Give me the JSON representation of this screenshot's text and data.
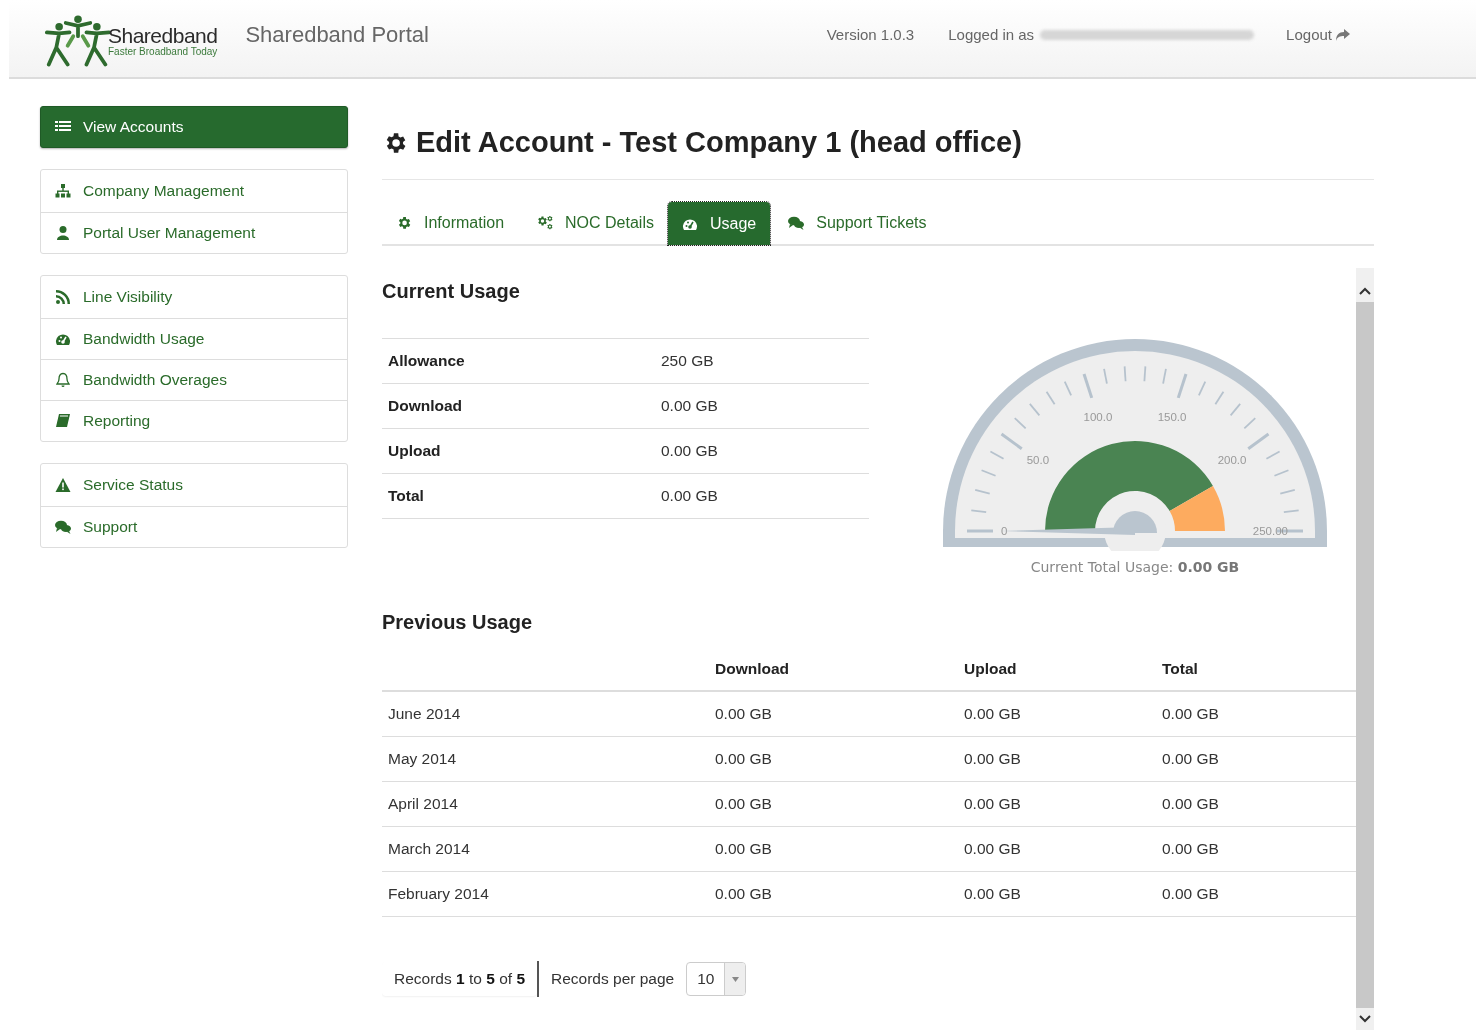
{
  "header": {
    "brand": "Sharedband",
    "tagline": "Faster Broadband Today",
    "portal": "Sharedband Portal",
    "version": "Version 1.0.3",
    "logged_in": "Logged in as",
    "logout": "Logout"
  },
  "sidebar": {
    "groups": [
      [
        {
          "label": "View Accounts",
          "selected": true
        }
      ],
      [
        {
          "label": "Company Management",
          "selected": false
        },
        {
          "label": "Portal User Management",
          "selected": false
        }
      ],
      [
        {
          "label": "Line Visibility",
          "selected": false
        },
        {
          "label": "Bandwidth Usage",
          "selected": false
        },
        {
          "label": "Bandwidth Overages",
          "selected": false
        },
        {
          "label": "Reporting",
          "selected": false
        }
      ],
      [
        {
          "label": "Service Status",
          "selected": false
        },
        {
          "label": "Support",
          "selected": false
        }
      ]
    ]
  },
  "page_title": "Edit Account - Test Company 1 (head office)",
  "tabs": [
    {
      "label": "Information",
      "selected": false
    },
    {
      "label": "NOC Details",
      "selected": false
    },
    {
      "label": "Usage",
      "selected": true
    },
    {
      "label": "Support Tickets",
      "selected": false
    }
  ],
  "current_usage": {
    "heading": "Current Usage",
    "rows": [
      {
        "label": "Allowance",
        "value": "250 GB"
      },
      {
        "label": "Download",
        "value": "0.00 GB"
      },
      {
        "label": "Upload",
        "value": "0.00 GB"
      },
      {
        "label": "Total",
        "value": "0.00 GB"
      }
    ],
    "gauge": {
      "ticks": [
        "0",
        "50.0",
        "100.0",
        "150.0",
        "200.0",
        "250.00"
      ],
      "caption": "Current Total Usage: **0.00 GB**"
    }
  },
  "previous_usage": {
    "heading": "Previous Usage",
    "columns": [
      "",
      "Download",
      "Upload",
      "Total"
    ],
    "rows": [
      [
        "June 2014",
        "0.00 GB",
        "0.00 GB",
        "0.00 GB"
      ],
      [
        "May 2014",
        "0.00 GB",
        "0.00 GB",
        "0.00 GB"
      ],
      [
        "April 2014",
        "0.00 GB",
        "0.00 GB",
        "0.00 GB"
      ],
      [
        "March 2014",
        "0.00 GB",
        "0.00 GB",
        "0.00 GB"
      ],
      [
        "February 2014",
        "0.00 GB",
        "0.00 GB",
        "0.00 GB"
      ]
    ],
    "records": "Records **1** to **5** of **5**",
    "per_page_label": "Records per page",
    "per_page": "10"
  }
}
